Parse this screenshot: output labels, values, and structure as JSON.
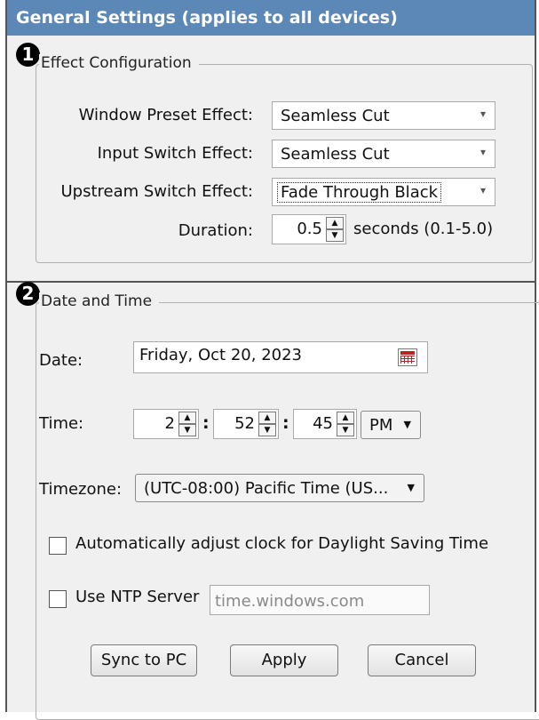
{
  "title": "General Settings (applies to all devices)",
  "effect_section": {
    "badge": "1",
    "legend": "Effect Configuration",
    "window_preset": {
      "label": "Window Preset Effect:",
      "value": "Seamless Cut"
    },
    "input_switch": {
      "label": "Input Switch Effect:",
      "value": "Seamless Cut"
    },
    "upstream_switch": {
      "label": "Upstream Switch Effect:",
      "value": "Fade Through Black"
    },
    "duration": {
      "label": "Duration:",
      "value": "0.5",
      "unit_text": "seconds (0.1-5.0)"
    }
  },
  "datetime_section": {
    "badge": "2",
    "legend": "Date and Time",
    "date": {
      "label": "Date:",
      "value": "Friday, Oct 20, 2023"
    },
    "time": {
      "label": "Time:",
      "hour": "2",
      "minute": "52",
      "second": "45",
      "ampm": "PM",
      "separator": ":"
    },
    "timezone": {
      "label": "Timezone:",
      "value": "(UTC-08:00) Pacific Time (US..."
    },
    "dst_checkbox": {
      "label": "Automatically adjust clock for Daylight Saving Time",
      "checked": false
    },
    "ntp": {
      "label": "Use NTP Server",
      "checked": false,
      "server": "time.windows.com"
    }
  },
  "buttons": {
    "sync": "Sync to PC",
    "apply": "Apply",
    "cancel": "Cancel"
  },
  "icons": {
    "arrow_down": "▾",
    "arrow_up": "▲",
    "arrow_dn_small": "▼"
  },
  "colors": {
    "title_bar": "#5b88b6",
    "panel_bg": "#f0f0f0"
  }
}
